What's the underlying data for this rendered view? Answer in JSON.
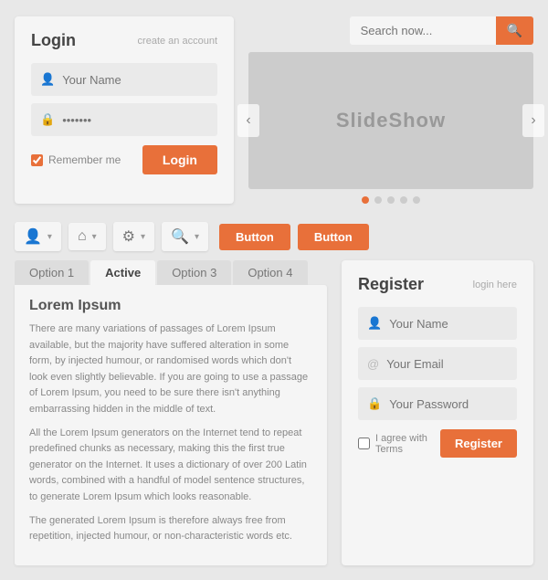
{
  "search": {
    "placeholder": "Search now...",
    "button_icon": "🔍"
  },
  "login": {
    "title": "Login",
    "create_account": "create an account",
    "name_placeholder": "Your Name",
    "password_placeholder": "•••••••",
    "remember_label": "Remember me",
    "button_label": "Login"
  },
  "slideshow": {
    "label": "SlideShow",
    "dots": [
      "active",
      "",
      "",
      "",
      ""
    ],
    "left_arrow": "‹",
    "right_arrow": "›"
  },
  "nav": {
    "groups": [
      {
        "icon": "👤",
        "label": "user-icon"
      },
      {
        "icon": "🏠",
        "label": "home-icon"
      },
      {
        "icon": "⚙",
        "label": "gear-icon"
      },
      {
        "icon": "🔍",
        "label": "search-icon"
      }
    ],
    "chevron": "▾",
    "buttons": [
      "Button",
      "Button"
    ]
  },
  "tabs": {
    "items": [
      "Option 1",
      "Active",
      "Option 3",
      "Option 4"
    ],
    "active_index": 1,
    "content_title": "Lorem Ipsum",
    "content_paragraphs": [
      "There are many variations of passages of Lorem Ipsum available, but the majority have suffered alteration in some form, by injected humour, or randomised words which don't look even slightly believable. If you are going to use a passage of Lorem Ipsum, you need to be sure there isn't anything embarrassing hidden in the middle of text.",
      "All the Lorem Ipsum generators on the Internet tend to repeat predefined chunks as necessary, making this the first true generator on the Internet. It uses a dictionary of over 200 Latin words, combined with a handful of model sentence structures, to generate Lorem Ipsum which looks reasonable.",
      "The generated Lorem Ipsum is therefore always free from repetition, injected humour, or non-characteristic words etc."
    ]
  },
  "register": {
    "title": "Register",
    "login_here": "login here",
    "name_placeholder": "Your Name",
    "email_placeholder": "Your Email",
    "password_placeholder": "Your Password",
    "agree_label": "I agree with Terms",
    "button_label": "Register"
  }
}
